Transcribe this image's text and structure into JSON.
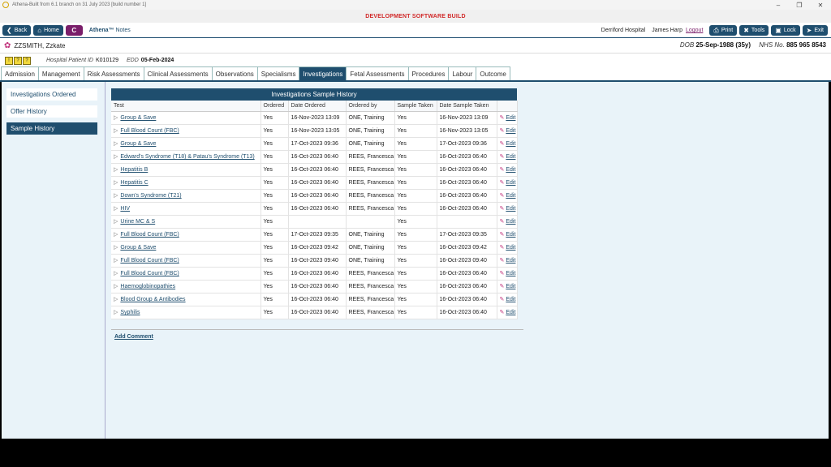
{
  "titlebar": {
    "title": "Athena-Built from 6.1 branch on 31 July 2023 [build number 1]"
  },
  "banner": {
    "text": "DEVELOPMENT SOFTWARE BUILD"
  },
  "toolbar": {
    "back_label": "Back",
    "home_label": "Home",
    "c_label": "C",
    "brand": "Athena™",
    "brand_sub": "Notes",
    "location": "Derriford Hospital",
    "user": "James Harp",
    "logout_label": "Logout",
    "print_label": "Print",
    "tools_label": "Tools",
    "lock_label": "Lock",
    "exit_label": "Exit"
  },
  "patient": {
    "name": "ZZSMITH, Zzkate",
    "dob_label": "DOB",
    "dob_value": "25-Sep-1988 (35y)",
    "nhs_label": "NHS No.",
    "nhs_value": "885 965 8543"
  },
  "info": {
    "alerts": [
      "!",
      "?",
      "?"
    ],
    "hpid_label": "Hospital Patient ID",
    "hpid_value": "K010129",
    "edd_label": "EDD",
    "edd_value": "05-Feb-2024"
  },
  "tabs": [
    "Admission",
    "Management",
    "Risk Assessments",
    "Clinical Assessments",
    "Observations",
    "Specialisms",
    "Investigations",
    "Fetal Assessments",
    "Procedures",
    "Labour",
    "Outcome"
  ],
  "sidebar": [
    "Investigations Ordered",
    "Offer History",
    "Sample History"
  ],
  "panel": {
    "title": "Investigations Sample History",
    "headers": [
      "Test",
      "Ordered",
      "Date Ordered",
      "Ordered by",
      "Sample Taken",
      "Date Sample Taken",
      ""
    ],
    "edit_label": "Edit",
    "rows": [
      [
        "Group & Save",
        "Yes",
        "16-Nov-2023 13:09",
        "ONE, Training",
        "Yes",
        "16-Nov-2023 13:09"
      ],
      [
        "Full Blood Count (FBC)",
        "Yes",
        "16-Nov-2023 13:05",
        "ONE, Training",
        "Yes",
        "16-Nov-2023 13:05"
      ],
      [
        "Group & Save",
        "Yes",
        "17-Oct-2023 09:36",
        "ONE, Training",
        "Yes",
        "17-Oct-2023 09:36"
      ],
      [
        "Edward's Syndrome (T18) & Patau's Syndrome (T13)",
        "Yes",
        "16-Oct-2023 06:40",
        "REES, Francesca",
        "Yes",
        "16-Oct-2023 06:40"
      ],
      [
        "Hepatitis B",
        "Yes",
        "16-Oct-2023 06:40",
        "REES, Francesca",
        "Yes",
        "16-Oct-2023 06:40"
      ],
      [
        "Hepatitis C",
        "Yes",
        "16-Oct-2023 06:40",
        "REES, Francesca",
        "Yes",
        "16-Oct-2023 06:40"
      ],
      [
        "Down's Syndrome (T21)",
        "Yes",
        "16-Oct-2023 06:40",
        "REES, Francesca",
        "Yes",
        "16-Oct-2023 06:40"
      ],
      [
        "HIV",
        "Yes",
        "16-Oct-2023 06:40",
        "REES, Francesca",
        "Yes",
        "16-Oct-2023 06:40"
      ],
      [
        "Urine MC & S",
        "Yes",
        "",
        "",
        "Yes",
        ""
      ],
      [
        "Full Blood Count (FBC)",
        "Yes",
        "17-Oct-2023 09:35",
        "ONE, Training",
        "Yes",
        "17-Oct-2023 09:35"
      ],
      [
        "Group & Save",
        "Yes",
        "16-Oct-2023 09:42",
        "ONE, Training",
        "Yes",
        "16-Oct-2023 09:42"
      ],
      [
        "Full Blood Count (FBC)",
        "Yes",
        "16-Oct-2023 09:40",
        "ONE, Training",
        "Yes",
        "16-Oct-2023 09:40"
      ],
      [
        "Full Blood Count (FBC)",
        "Yes",
        "16-Oct-2023 06:40",
        "REES, Francesca",
        "Yes",
        "16-Oct-2023 06:40"
      ],
      [
        "Haemoglobinopathies",
        "Yes",
        "16-Oct-2023 06:40",
        "REES, Francesca",
        "Yes",
        "16-Oct-2023 06:40"
      ],
      [
        "Blood Group & Antibodies",
        "Yes",
        "16-Oct-2023 06:40",
        "REES, Francesca",
        "Yes",
        "16-Oct-2023 06:40"
      ],
      [
        "Syphilis",
        "Yes",
        "16-Oct-2023 06:40",
        "REES, Francesca",
        "Yes",
        "16-Oct-2023 06:40"
      ]
    ],
    "add_comment_label": "Add Comment"
  },
  "icons": {
    "back": "chevron-left-icon",
    "home": "home-icon",
    "print": "printer-icon",
    "tools": "tools-icon",
    "lock": "lock-icon",
    "exit": "exit-icon",
    "patient": "flower-icon",
    "expand": "triangle-right-icon",
    "edit": "pencil-icon"
  },
  "colors": {
    "primary": "#1f4e6e",
    "accent": "#7a1e6a",
    "dev_banner": "#d12a2a",
    "background": "#e9f3f9"
  }
}
